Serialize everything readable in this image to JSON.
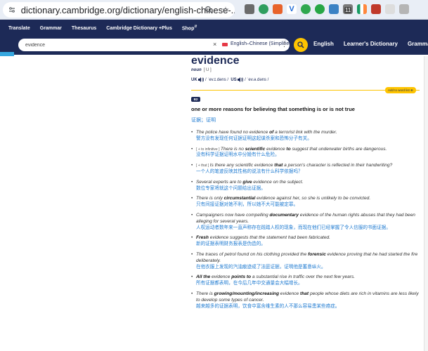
{
  "browser": {
    "url": "dictionary.cambridge.org/dictionary/english-chinese-...",
    "extension_badge": "11"
  },
  "nav": {
    "items": [
      "Translate",
      "Grammar",
      "Thesaurus",
      "Cambridge Dictionary +Plus",
      "Shop"
    ],
    "shop_sup": "⇵"
  },
  "search": {
    "value": "evidence",
    "clear": "×",
    "language": "English–Chinese (Simplified)",
    "menu": "⋮",
    "right_links": [
      "English",
      "Learner's Dictionary",
      "Grammar"
    ]
  },
  "entry": {
    "headword": "evidence",
    "pos": "noun",
    "grammar": "[ U ]",
    "uk_label": "UK",
    "uk_pron": "/ ˈev.ɪ.dəns /",
    "us_label": "US",
    "us_pron": "/ ˈev.ə.dəns /",
    "add_to_wordlist": "Add to word list",
    "level": "B2",
    "definition": "one or more reasons for believing that something is or is not true",
    "translation": "证据；证明"
  },
  "examples": [
    {
      "grammar": "",
      "parts": [
        [
          "The police have found no evidence ",
          false
        ],
        [
          "of",
          true
        ],
        [
          " a terrorist link with the murder.",
          false
        ]
      ],
      "zh": "警方没有发现任何证据证明这起谋杀案和恐怖分子有关。"
    },
    {
      "grammar": "[ + to infinitive ]",
      "parts": [
        [
          "There is no ",
          false
        ],
        [
          "scientific",
          true
        ],
        [
          " evidence ",
          false
        ],
        [
          "to",
          true
        ],
        [
          " suggest that underwater births are dangerous.",
          false
        ]
      ],
      "zh": "没有科学证据证明水中分娩有什么危险。"
    },
    {
      "grammar": "[ + that ]",
      "parts": [
        [
          "Is there any scientific evidence ",
          false
        ],
        [
          "that",
          true
        ],
        [
          " a person's character is reflected in their handwriting?",
          false
        ]
      ],
      "zh": "一个人的笔迹反映其性格的说法有什么科学依据吗？"
    },
    {
      "grammar": "",
      "parts": [
        [
          "Several experts are to ",
          false
        ],
        [
          "give",
          true
        ],
        [
          " evidence on the subject.",
          false
        ]
      ],
      "zh": "数位专家将就这个问题给出证据。"
    },
    {
      "grammar": "",
      "parts": [
        [
          "There is only ",
          false
        ],
        [
          "circumstantial",
          true
        ],
        [
          " evidence against her, so she is unlikely to be convicted.",
          false
        ]
      ],
      "zh": "只有间接证据对她不利，所以她不大可能被定罪。"
    },
    {
      "grammar": "",
      "parts": [
        [
          "Campaigners now have compelling ",
          false
        ],
        [
          "documentary",
          true
        ],
        [
          " evidence of the human rights abuses that they had been alleging for several years.",
          false
        ]
      ],
      "zh": "人权运动者数年来一直声称存在践踏人权的现象，而现在他们已经掌握了令人信服的书面证据。"
    },
    {
      "grammar": "",
      "parts": [
        [
          "Fresh",
          true
        ],
        [
          " evidence suggests that the statement had been fabricated.",
          false
        ]
      ],
      "zh": "新的证据表明财务报表是伪造的。"
    },
    {
      "grammar": "",
      "parts": [
        [
          "The traces of petrol found on his clothing provided the ",
          false
        ],
        [
          "forensic",
          true
        ],
        [
          " evidence proving that he had started the fire deliberately.",
          false
        ]
      ],
      "zh": "在他衣服上发现的汽油痕迹成了法庭证据，证明他是蓄意纵火。"
    },
    {
      "grammar": "",
      "parts": [
        [
          "All the",
          true
        ],
        [
          " evidence ",
          false
        ],
        [
          "points to",
          true
        ],
        [
          " a substantial rise in traffic over the next few years.",
          false
        ]
      ],
      "zh": "所有证据都表明，在今后几年中交通量会大幅增长。"
    },
    {
      "grammar": "",
      "parts": [
        [
          "There is ",
          false
        ],
        [
          "growing/mounting/increasing",
          true
        ],
        [
          " evidence ",
          false
        ],
        [
          "that",
          true
        ],
        [
          " people whose diets are rich in vitamins are less likely to develop some types of cancer.",
          false
        ]
      ],
      "zh": "越来越多的证据表明，饮食中富含维生素的人不那么容易患某些癌症。"
    }
  ]
}
